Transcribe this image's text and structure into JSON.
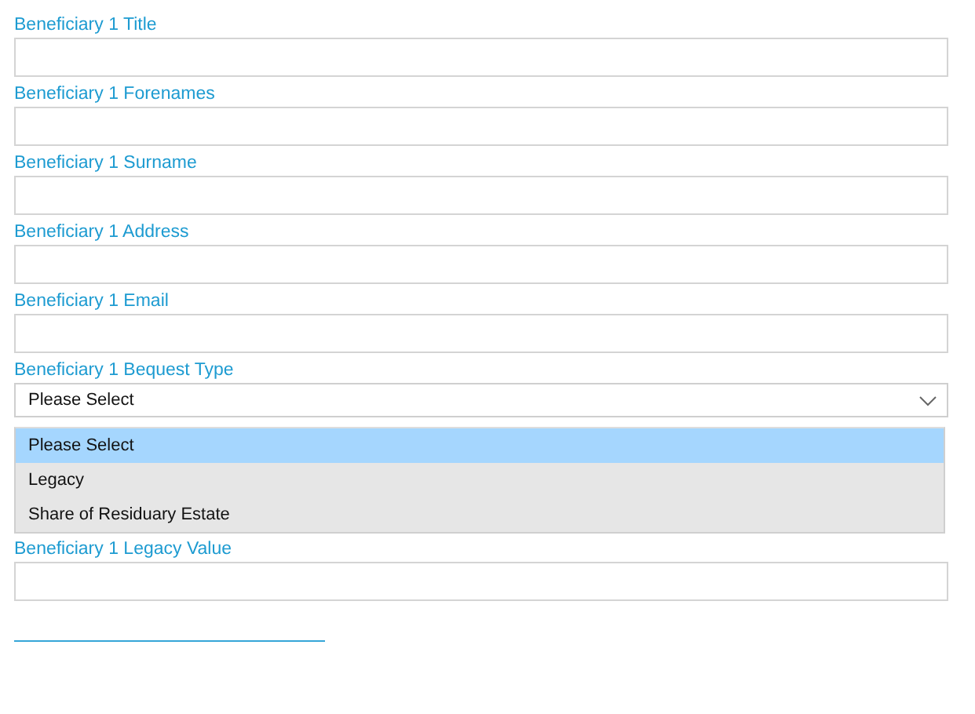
{
  "fields": [
    {
      "kind": "text",
      "label": "Beneficiary 1 Title"
    },
    {
      "kind": "text",
      "label": "Beneficiary 1 Forenames"
    },
    {
      "kind": "text",
      "label": "Beneficiary 1 Surname"
    },
    {
      "kind": "text",
      "label": "Beneficiary 1 Address"
    },
    {
      "kind": "text",
      "label": "Beneficiary 1 Email"
    },
    {
      "kind": "select",
      "label": "Beneficiary 1 Bequest Type",
      "value": "Please Select",
      "expanded": true,
      "options": [
        {
          "label": "Please Select",
          "selected": true
        },
        {
          "label": "Legacy",
          "selected": false
        },
        {
          "label": "Share of Residuary Estate",
          "selected": false
        }
      ]
    },
    {
      "kind": "text",
      "label": "Beneficiary 1 Legacy Value"
    }
  ]
}
